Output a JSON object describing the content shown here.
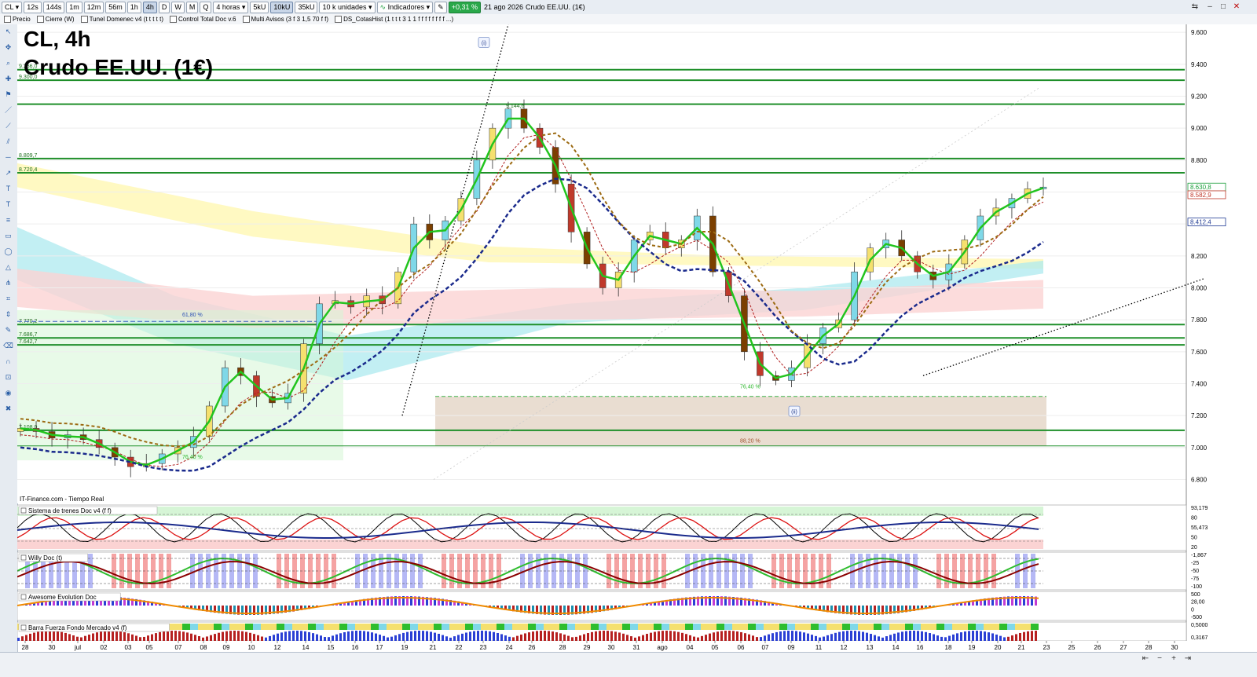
{
  "toolbar": {
    "symbol": "CL",
    "timeframes": [
      "12s",
      "144s",
      "1m",
      "12m",
      "56m",
      "1h",
      "4h",
      "D",
      "W",
      "M",
      "Q"
    ],
    "active_timeframe": "4h",
    "period_select": "4 horas",
    "volume_buttons": [
      "5kU",
      "10kU",
      "35kU"
    ],
    "active_volume": "10kU",
    "units_select": "10 k unidades",
    "indicators_label": "Indicadores",
    "change_badge": "+0,31 %",
    "date_text": "21 ago 2026",
    "instrument_text": "Crudo EE.UU. (1€)",
    "colors": {
      "up": "#1a9e3a",
      "badge": "#2aa84a"
    }
  },
  "indicator_bar": {
    "items": [
      "Precio",
      "Cierre (W)",
      "Tunel Domenec v4 (t t t t t)",
      "Control Total Doc v.6",
      "Multi Avisos (3 f 3 1,5 70 f f)",
      "DS_CotasHist (1 t t t 3 1 1 f f f f f f f f ...)"
    ]
  },
  "chart": {
    "title_line1": "CL, 4h",
    "title_line2": "Crudo EE.UU. (1€)",
    "source_label": "IT-Finance.com - Tiempo Real",
    "price_axis_labels": [
      "9.600",
      "9.400",
      "9.200",
      "9.000",
      "8.800",
      "8.600",
      "8.400",
      "8.200",
      "8.000",
      "7.800",
      "7.600",
      "7.400",
      "7.200",
      "7.000",
      "6.800"
    ],
    "price_axis_values": [
      9600,
      9400,
      9200,
      9000,
      8800,
      8600,
      8400,
      8200,
      8000,
      7800,
      7600,
      7400,
      7200,
      7000,
      6800
    ],
    "horizontal_levels": [
      {
        "label": "9.366,0",
        "value": 9366
      },
      {
        "label": "9.300,0",
        "value": 9300
      },
      {
        "label": "",
        "value": 9150
      },
      {
        "label": "8.809,7",
        "value": 8809.7
      },
      {
        "label": "8.720,4",
        "value": 8720.4
      },
      {
        "label": "7.770,2",
        "value": 7770.2
      },
      {
        "label": "7.686,7",
        "value": 7686.7
      },
      {
        "label": "7.642,7",
        "value": 7642.7
      },
      {
        "label": "7.108,0",
        "value": 7108
      },
      {
        "label": "",
        "value": 7010
      }
    ],
    "peak_label": "9.144,6",
    "fib_labels": [
      {
        "text": "61,80 %",
        "value": 7820
      },
      {
        "text": "76,40 %",
        "value": 7370
      },
      {
        "text": "76,40 %",
        "value": 6930
      },
      {
        "text": "88,20 %",
        "value": 7030
      }
    ],
    "last_price_tags": [
      {
        "text": "8.630,8",
        "value": 8630.8,
        "color": "#1a9e3a"
      },
      {
        "text": "8.582,9",
        "value": 8582.9,
        "color": "#c0392b"
      },
      {
        "text": "8.412,4",
        "value": 8412.4,
        "color": "#1f3a93"
      }
    ],
    "wave_markers": [
      "(i)",
      "(ii)"
    ],
    "y_range": [
      6650,
      9650
    ]
  },
  "panels": [
    {
      "title": "Sistema de trenes Doc v4 (f f)",
      "axis_labels": [
        "93,179",
        "80",
        "55,473",
        "50",
        "20"
      ]
    },
    {
      "title": "Willy Doc (t)",
      "axis_labels": [
        "-1,867",
        "-25",
        "-50",
        "-75",
        "-100"
      ]
    },
    {
      "title": "Awesome Evolution Doc",
      "axis_labels": [
        "500",
        "28,00",
        "0",
        "-500"
      ]
    },
    {
      "title": "Barra Fuerza Fondo Mercado v4 (f)",
      "axis_labels": [
        "0,5000",
        "0,3167"
      ]
    }
  ],
  "x_axis": {
    "labels": [
      "28",
      "30",
      "jul",
      "02",
      "03",
      "05",
      "07",
      "08",
      "09",
      "10",
      "12",
      "14",
      "15",
      "16",
      "17",
      "19",
      "21",
      "22",
      "23",
      "24",
      "26",
      "28",
      "29",
      "30",
      "31",
      "ago",
      "04",
      "05",
      "06",
      "07",
      "09",
      "11",
      "12",
      "13",
      "14",
      "16",
      "18",
      "19",
      "20",
      "21",
      "23",
      "25",
      "26",
      "27",
      "28",
      "30"
    ],
    "positions": [
      10,
      44,
      77,
      110,
      141,
      168,
      205,
      237,
      266,
      298,
      331,
      367,
      399,
      430,
      461,
      493,
      529,
      562,
      593,
      626,
      655,
      694,
      725,
      756,
      788,
      821,
      856,
      888,
      921,
      952,
      985,
      1020,
      1052,
      1085,
      1118,
      1149,
      1185,
      1215,
      1248,
      1278,
      1310,
      1342,
      1375,
      1408,
      1440,
      1473
    ]
  },
  "series_data": {
    "closes": [
      7120,
      7100,
      7060,
      7080,
      7050,
      7000,
      6940,
      6880,
      6900,
      6960,
      7000,
      7070,
      7260,
      7500,
      7450,
      7320,
      7280,
      7340,
      7650,
      7900,
      7920,
      7880,
      7950,
      7900,
      8100,
      8400,
      8300,
      8420,
      8560,
      8800,
      9000,
      9120,
      9000,
      8880,
      8650,
      8350,
      8150,
      8000,
      8100,
      8300,
      8350,
      8250,
      8300,
      8450,
      8100,
      7950,
      7600,
      7450,
      7420,
      7500,
      7650,
      7750,
      7800,
      8100,
      8250,
      8300,
      8200,
      8100,
      8050,
      8150,
      8300,
      8450,
      8500,
      8560,
      8620,
      8631
    ]
  }
}
